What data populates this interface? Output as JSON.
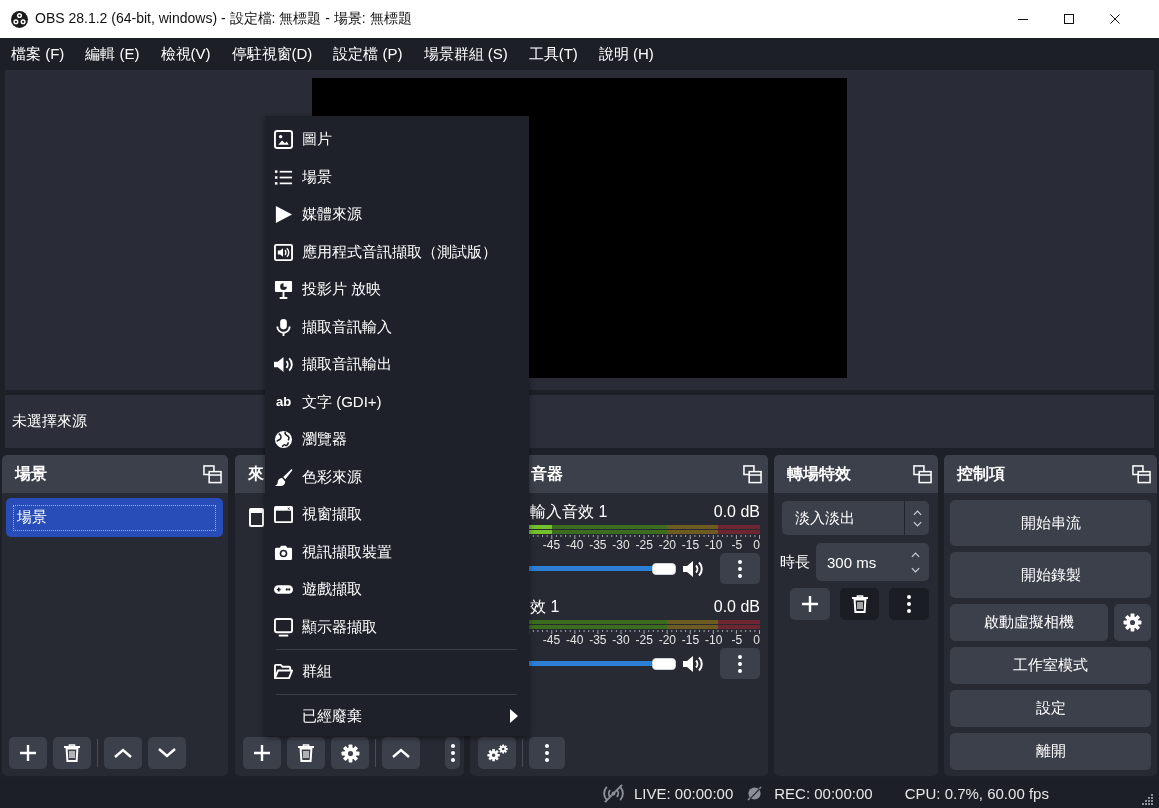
{
  "window": {
    "title": "OBS 28.1.2 (64-bit, windows) - 設定檔: 無標題 - 場景: 無標題"
  },
  "menu_bar": [
    "檔案 (F)",
    "編輯 (E)",
    "檢視(V)",
    "停駐視窗(D)",
    "設定檔 (P)",
    "場景群組 (S)",
    "工具(T)",
    "說明 (H)"
  ],
  "preview": {
    "context_bar": "未選擇來源"
  },
  "scenes": {
    "title": "場景",
    "items": [
      {
        "label": "場景",
        "selected": true
      }
    ]
  },
  "sources": {
    "title": "來"
  },
  "mixer": {
    "title": "音器",
    "channels": [
      {
        "name": "輸入音效 1",
        "reading": "0.0 dB",
        "meter": {
          "level": 0.25
        },
        "fader": {
          "level": 1
        },
        "scale": [
          "-45",
          "-40",
          "-35",
          "-30",
          "-25",
          "-20",
          "-15",
          "-10",
          "-5",
          "0"
        ]
      },
      {
        "name": "效 1",
        "reading": "0.0 dB",
        "fader": {
          "level": 1
        },
        "scale": [
          "-45",
          "-40",
          "-35",
          "-30",
          "-25",
          "-20",
          "-15",
          "-10",
          "-5",
          "0"
        ]
      }
    ]
  },
  "transitions": {
    "title": "轉場特效",
    "transition": "淡入淡出",
    "duration_label": "時長",
    "duration": "300 ms",
    "buttons": [
      {
        "kind": "add",
        "disabled": false
      },
      {
        "kind": "remove",
        "disabled": true
      },
      {
        "kind": "menu",
        "disabled": true
      }
    ]
  },
  "controls": {
    "title": "控制項",
    "buttons": [
      {
        "label": "開始串流",
        "kind": "tall"
      },
      {
        "label": "開始錄製",
        "kind": "tall"
      },
      {
        "label": "啟動虛擬相機",
        "kind": "split"
      },
      {
        "label": "工作室模式",
        "kind": "plain"
      },
      {
        "label": "設定",
        "kind": "plain"
      },
      {
        "label": "離開",
        "kind": "plain"
      }
    ]
  },
  "context_menu": {
    "items": [
      {
        "kind": "item",
        "label": "圖片"
      },
      {
        "kind": "item",
        "label": "場景"
      },
      {
        "kind": "item",
        "label": "媒體來源"
      },
      {
        "kind": "item",
        "label": "應用程式音訊擷取（測試版）"
      },
      {
        "kind": "item",
        "label": "投影片 放映"
      },
      {
        "kind": "item",
        "label": "擷取音訊輸入"
      },
      {
        "kind": "item",
        "label": "擷取音訊輸出"
      },
      {
        "kind": "item",
        "label": "文字 (GDI+)",
        "icon_text": "ab"
      },
      {
        "kind": "item",
        "label": "瀏覽器"
      },
      {
        "kind": "item",
        "label": "色彩來源"
      },
      {
        "kind": "item",
        "label": "視窗擷取"
      },
      {
        "kind": "item",
        "label": "視訊擷取裝置"
      },
      {
        "kind": "item",
        "label": "遊戲擷取"
      },
      {
        "kind": "item",
        "label": "顯示器擷取"
      },
      {
        "kind": "separator"
      },
      {
        "kind": "item",
        "label": "群組"
      },
      {
        "kind": "separator"
      },
      {
        "kind": "submenu",
        "label": "已經廢棄"
      }
    ]
  },
  "status_bar": {
    "live": "LIVE: 00:00:00",
    "rec": "REC: 00:00:00",
    "cpu": "CPU: 0.7%, 60.00 fps"
  }
}
